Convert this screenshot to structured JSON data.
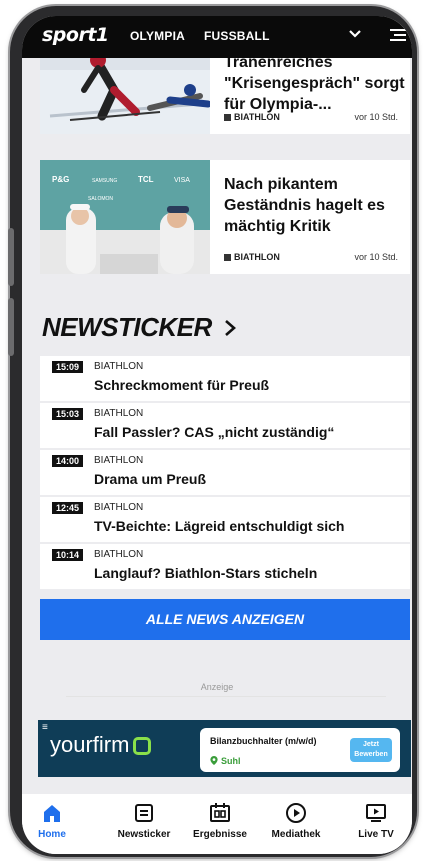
{
  "header": {
    "logo": "sport1",
    "nav": [
      "OLYMPIA",
      "FUSSBALL"
    ]
  },
  "articles": [
    {
      "title": "Tränenreiches \"Krisengespräch\" sorgt für Olympia-...",
      "category": "BIATHLON",
      "time": "vor 10 Std."
    },
    {
      "title": "Nach pikantem Geständnis hagelt es mächtig Kritik",
      "category": "BIATHLON",
      "time": "vor 10 Std.",
      "backdrop_logos": [
        "P&G",
        "SAMSUNG",
        "TCL",
        "VISA",
        "SALOMON"
      ]
    }
  ],
  "newsticker": {
    "heading": "NEWSTICKER",
    "items": [
      {
        "time": "15:09",
        "category": "BIATHLON",
        "title": "Schreckmoment für Preuß"
      },
      {
        "time": "15:03",
        "category": "BIATHLON",
        "title": "Fall Passler? CAS „nicht zuständig“"
      },
      {
        "time": "14:00",
        "category": "BIATHLON",
        "title": "Drama um Preuß"
      },
      {
        "time": "12:45",
        "category": "BIATHLON",
        "title": "TV-Beichte: Lägreid entschuldigt sich"
      },
      {
        "time": "10:14",
        "category": "BIATHLON",
        "title": "Langlauf? Biathlon-Stars sticheln"
      }
    ],
    "all_news_label": "ALLE NEWS ANZEIGEN"
  },
  "ad": {
    "label": "Anzeige",
    "brand": "yourfirm",
    "job_title": "Bilanzbuchhalter (m/w/d)",
    "location": "Suhl",
    "button": "Jetzt Bewerben"
  },
  "bottom_nav": [
    {
      "label": "Home",
      "icon": "home-icon",
      "active": true
    },
    {
      "label": "Newsticker",
      "icon": "newsticker-icon",
      "active": false
    },
    {
      "label": "Ergebnisse",
      "icon": "results-icon",
      "active": false
    },
    {
      "label": "Mediathek",
      "icon": "play-icon",
      "active": false
    },
    {
      "label": "Live TV",
      "icon": "live-tv-icon",
      "active": false
    }
  ],
  "colors": {
    "accent": "#1f6fec",
    "header_bg": "#0a0a0a",
    "page_bg": "#ececef",
    "ad_bg": "#0f3d57",
    "ad_green": "#8ae04a"
  }
}
